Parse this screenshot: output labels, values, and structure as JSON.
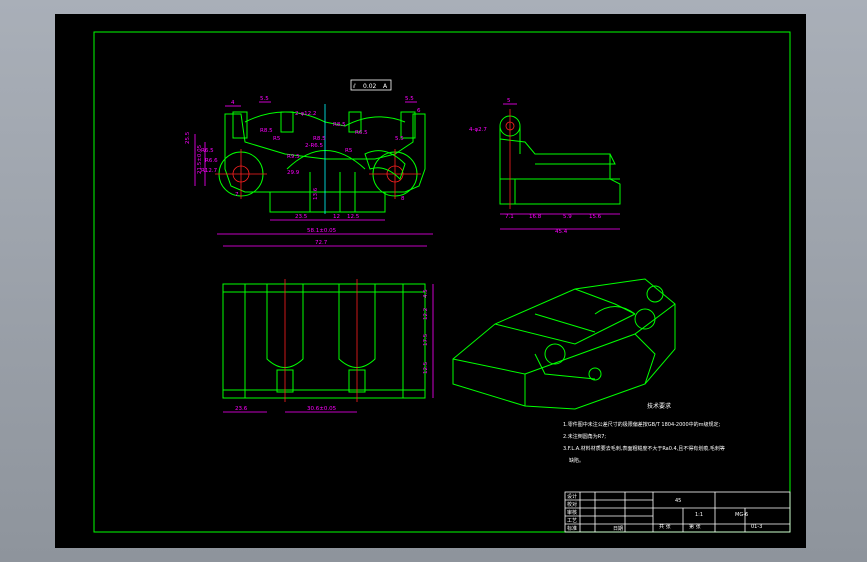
{
  "drawing": {
    "tolerance_frame": {
      "symbol": "⫽",
      "value": "0.02",
      "datum": "A"
    },
    "front_view_dims": [
      "4",
      "5.5",
      "5.5",
      "2-φ12.2",
      "R8.5",
      "R5",
      "R8.5",
      "R6.5",
      "R9.5",
      "R5",
      "2-R6.5",
      "R8.5",
      "R6.5",
      "R6.6",
      "R12.7",
      "25.5",
      "21.5±0.05",
      "29.9",
      "13.6",
      "23.5",
      "12",
      "12.5",
      "58.1±0.05",
      "72.7",
      "7",
      "8",
      "5.5",
      "6"
    ],
    "side_view_dims": [
      "5",
      "4-φ2.7",
      "7.1",
      "16.8",
      "5.9",
      "15.6",
      "45.4"
    ],
    "top_view_dims": [
      "4.5",
      "12.2",
      "17.5",
      "12.5",
      "23.6",
      "30.6±0.05"
    ],
    "tech_title": "技术要求",
    "tech_notes": [
      "1.零件图中未注公差尺寸的极限偏差按GB/T 1804-2000中的m级规定;",
      "2.未注倒圆角为R7;",
      "3.F.L.A.材料材质要去毛刺,表面粗糙度不大于Ra0.4,且不得有划痕,毛刺等",
      "缺陷。"
    ]
  },
  "title_block": {
    "labels": [
      "设计",
      "校对",
      "审核",
      "工艺",
      "标准",
      "日期"
    ],
    "material_label": "45",
    "scale_label": "1:1",
    "part_name": "MG-6",
    "sheet_label": "共  张",
    "page_label": "第  张",
    "code": "01-3"
  }
}
